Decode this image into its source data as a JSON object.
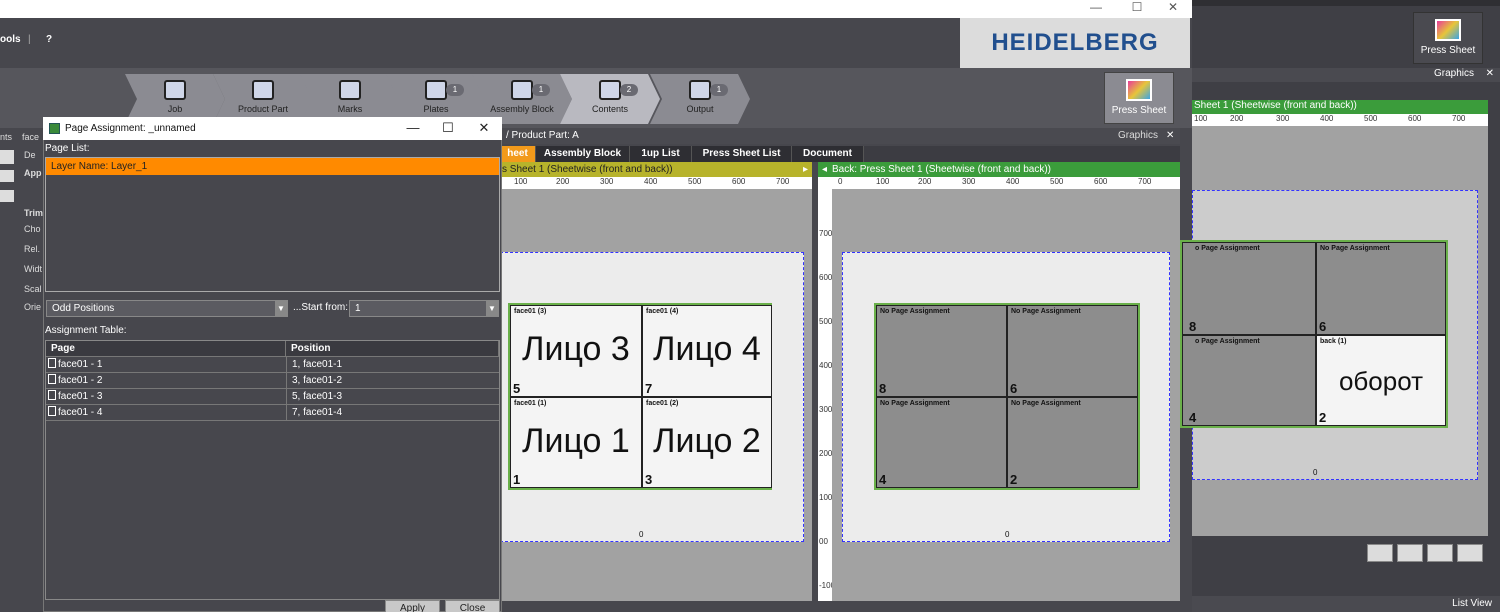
{
  "menu": {
    "tools": "ools",
    "separator": "|",
    "help": "?"
  },
  "logo": {
    "text_a": "HEIDELBERG"
  },
  "workflow": {
    "steps": [
      {
        "label": "Job",
        "badge": ""
      },
      {
        "label": "Product Part",
        "badge": ""
      },
      {
        "label": "Marks",
        "badge": ""
      },
      {
        "label": "Plates",
        "badge": "1"
      },
      {
        "label": "Assembly Block",
        "badge": "1"
      },
      {
        "label": "Contents",
        "badge": "2"
      },
      {
        "label": "Output",
        "badge": "1"
      }
    ],
    "press_sheet_label": "Press Sheet"
  },
  "graphics_panel": {
    "title": "Graphics",
    "product_part": "/ Product Part: A",
    "tabs": [
      "heet",
      "Assembly Block",
      "1up List",
      "Press Sheet List",
      "Document"
    ],
    "front_label": "s Sheet 1 (Sheetwise (front and back))",
    "back_label": "Back:  Press Sheet 1 (Sheetwise (front and back))",
    "ruler_ticks": [
      "100",
      "200",
      "300",
      "400",
      "500",
      "600",
      "700"
    ],
    "vruler_ticks": [
      "700",
      "600",
      "500",
      "400",
      "300",
      "200",
      "100",
      "00",
      "-100"
    ],
    "front_cells": [
      {
        "caption": "face01 (3)",
        "text": "Лицо 3",
        "num": "5"
      },
      {
        "caption": "face01 (4)",
        "text": "Лицо 4",
        "num": "7"
      },
      {
        "caption": "face01 (1)",
        "text": "Лицо 1",
        "num": "1"
      },
      {
        "caption": "face01 (2)",
        "text": "Лицо 2",
        "num": "3"
      }
    ],
    "back_cells": [
      {
        "caption": "No Page Assignment",
        "num": "8"
      },
      {
        "caption": "No Page Assignment",
        "num": "6"
      },
      {
        "caption": "No Page Assignment",
        "num": "4"
      },
      {
        "caption": "No Page Assignment",
        "num": "2"
      }
    ],
    "zero_label": "0"
  },
  "right_panel": {
    "press_sheet_label": "Press Sheet",
    "graphics_title": "Graphics",
    "green_label": "Sheet 1 (Sheetwise (front and back))",
    "ruler_ticks": [
      "100",
      "200",
      "300",
      "400",
      "500",
      "600",
      "700"
    ],
    "cells": [
      {
        "caption": "o Page Assignment",
        "num": "8",
        "text": ""
      },
      {
        "caption": "No Page Assignment",
        "num": "6",
        "text": ""
      },
      {
        "caption": "o Page Assignment",
        "num": "4",
        "text": ""
      },
      {
        "caption": "back (1)",
        "num": "2",
        "text": "оборот"
      }
    ],
    "zero_label": "0",
    "list_view_label": "List View"
  },
  "dialog": {
    "title": "Page Assignment: _unnamed",
    "page_list_label": "Page List:",
    "layer_item": "Layer Name: Layer_1",
    "positions_select": "Odd Positions",
    "start_from_label": "...Start from:",
    "start_from_value": "1",
    "assignment_table_label": "Assignment Table:",
    "columns": [
      "Page",
      "Position"
    ],
    "rows": [
      {
        "page": "face01 - 1",
        "position": "1, face01-1"
      },
      {
        "page": "face01 - 2",
        "position": "3, face01-2"
      },
      {
        "page": "face01 - 3",
        "position": "5, face01-3"
      },
      {
        "page": "face01 - 4",
        "position": "7, face01-4"
      }
    ],
    "apply_label": "Apply",
    "close_label": "Close"
  },
  "left_panel": {
    "labels": [
      "face",
      "nts",
      "De",
      "App",
      "Trim",
      "Cho",
      "Rel.",
      "Widt",
      "Scal",
      "Orie"
    ]
  }
}
